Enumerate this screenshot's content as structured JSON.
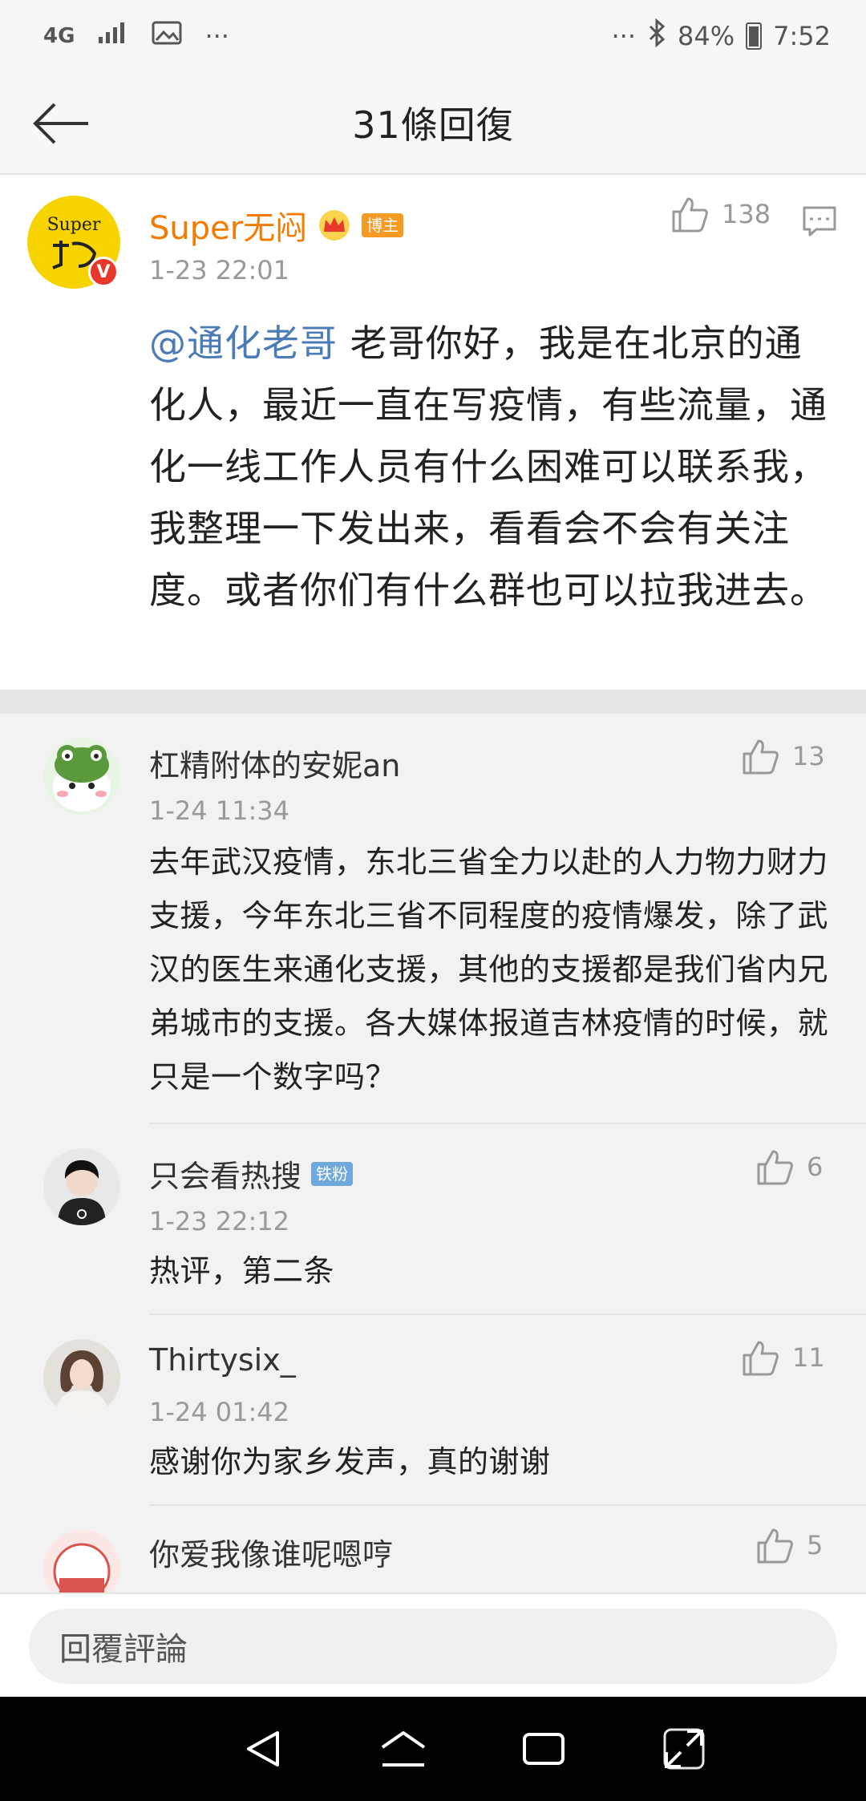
{
  "status_bar": {
    "network": "4G",
    "network_sub": "4G",
    "more": "···",
    "more_right": "···",
    "battery": "84%",
    "time": "7:52"
  },
  "header": {
    "title": "31條回復"
  },
  "main_comment": {
    "author": "Super无闷",
    "avatar_text": "Super",
    "badge": "博主",
    "time": "1-23 22:01",
    "likes": "138",
    "mention": "@通化老哥",
    "text": " 老哥你好，我是在北京的通化人，最近一直在写疫情，有些流量，通化一线工作人员有什么困难可以联系我，我整理一下发出来，看看会不会有关注度。或者你们有什么群也可以拉我进去。"
  },
  "comments": [
    {
      "author": "杠精附体的安妮an",
      "time": "1-24 11:34",
      "likes": "13",
      "text": "去年武汉疫情，东北三省全力以赴的人力物力财力支援，今年东北三省不同程度的疫情爆发，除了武汉的医生来通化支援，其他的支援都是我们省内兄弟城市的支援。各大媒体报道吉林疫情的时候，就只是一个数字吗？"
    },
    {
      "author": "只会看热搜",
      "badge": "铁粉",
      "time": "1-23 22:12",
      "likes": "6",
      "text": "热评，第二条"
    },
    {
      "author": "Thirtysix_",
      "time": "1-24 01:42",
      "likes": "11",
      "text": "感谢你为家乡发声，真的谢谢"
    },
    {
      "author": "你爱我像谁呢嗯哼",
      "likes": "5"
    }
  ],
  "reply_bar": {
    "placeholder": "回覆評論"
  },
  "colors": {
    "accent_orange": "#f57a00",
    "mention_blue": "#4c7cb8",
    "badge_orange": "#f59a23",
    "badge_blue": "#6fa8dc"
  }
}
